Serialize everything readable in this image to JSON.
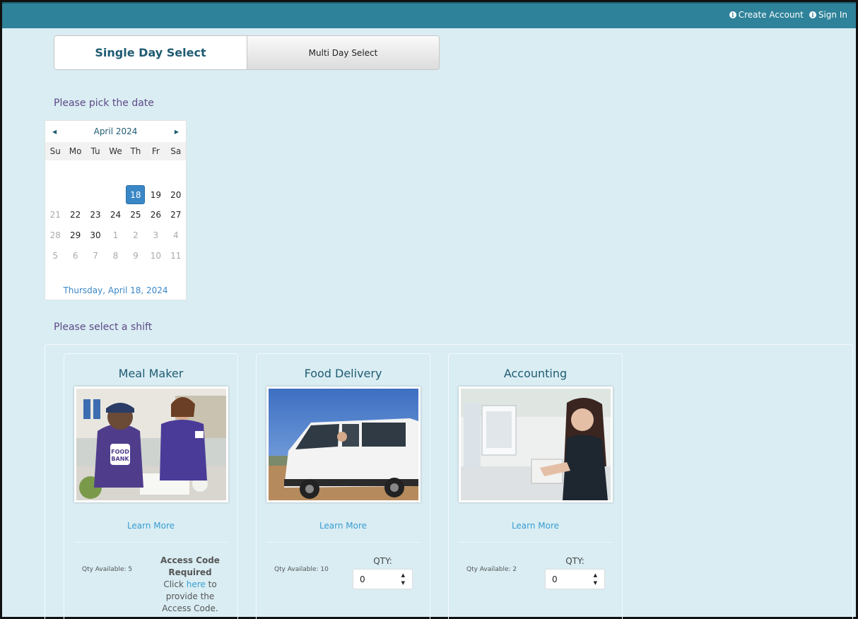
{
  "topnav": {
    "create_account": "Create Account",
    "sign_in": "Sign In"
  },
  "tabs": {
    "single": "Single Day Select",
    "multi": "Multi Day Select"
  },
  "labels": {
    "pick_date": "Please pick the date",
    "select_shift": "Please select a shift"
  },
  "calendar": {
    "month": "April 2024",
    "weekdays": [
      "Su",
      "Mo",
      "Tu",
      "We",
      "Th",
      "Fr",
      "Sa"
    ],
    "selected_day": "18",
    "selected_text": "Thursday, April 18, 2024",
    "days": [
      {
        "d": "",
        "s": "empty"
      },
      {
        "d": "",
        "s": "empty"
      },
      {
        "d": "",
        "s": "empty"
      },
      {
        "d": "",
        "s": "empty"
      },
      {
        "d": "",
        "s": "empty"
      },
      {
        "d": "",
        "s": "empty"
      },
      {
        "d": "",
        "s": "empty"
      },
      {
        "d": "",
        "s": "empty"
      },
      {
        "d": "",
        "s": "empty"
      },
      {
        "d": "",
        "s": "empty"
      },
      {
        "d": "",
        "s": "empty"
      },
      {
        "d": "18",
        "s": "selected"
      },
      {
        "d": "19",
        "s": ""
      },
      {
        "d": "20",
        "s": ""
      },
      {
        "d": "21",
        "s": "muted"
      },
      {
        "d": "22",
        "s": ""
      },
      {
        "d": "23",
        "s": ""
      },
      {
        "d": "24",
        "s": ""
      },
      {
        "d": "25",
        "s": ""
      },
      {
        "d": "26",
        "s": ""
      },
      {
        "d": "27",
        "s": ""
      },
      {
        "d": "28",
        "s": "muted"
      },
      {
        "d": "29",
        "s": ""
      },
      {
        "d": "30",
        "s": ""
      },
      {
        "d": "1",
        "s": "muted"
      },
      {
        "d": "2",
        "s": "muted"
      },
      {
        "d": "3",
        "s": "muted"
      },
      {
        "d": "4",
        "s": "muted"
      },
      {
        "d": "5",
        "s": "muted"
      },
      {
        "d": "6",
        "s": "muted"
      },
      {
        "d": "7",
        "s": "muted"
      },
      {
        "d": "8",
        "s": "muted"
      },
      {
        "d": "9",
        "s": "muted"
      },
      {
        "d": "10",
        "s": "muted"
      },
      {
        "d": "11",
        "s": "muted"
      }
    ]
  },
  "shifts": [
    {
      "title": "Meal Maker",
      "learn_more": "Learn More",
      "qty_available": "Qty Available: 5",
      "access_code_title": "Access Code Required",
      "access_code_pre": "Click",
      "access_code_link": "here",
      "access_code_post": "to provide the Access Code."
    },
    {
      "title": "Food Delivery",
      "learn_more": "Learn More",
      "qty_available": "Qty Available: 10",
      "qty_label": "QTY:",
      "qty_value": "0"
    },
    {
      "title": "Accounting",
      "learn_more": "Learn More",
      "qty_available": "Qty Available: 2",
      "qty_label": "QTY:",
      "qty_value": "0"
    }
  ]
}
